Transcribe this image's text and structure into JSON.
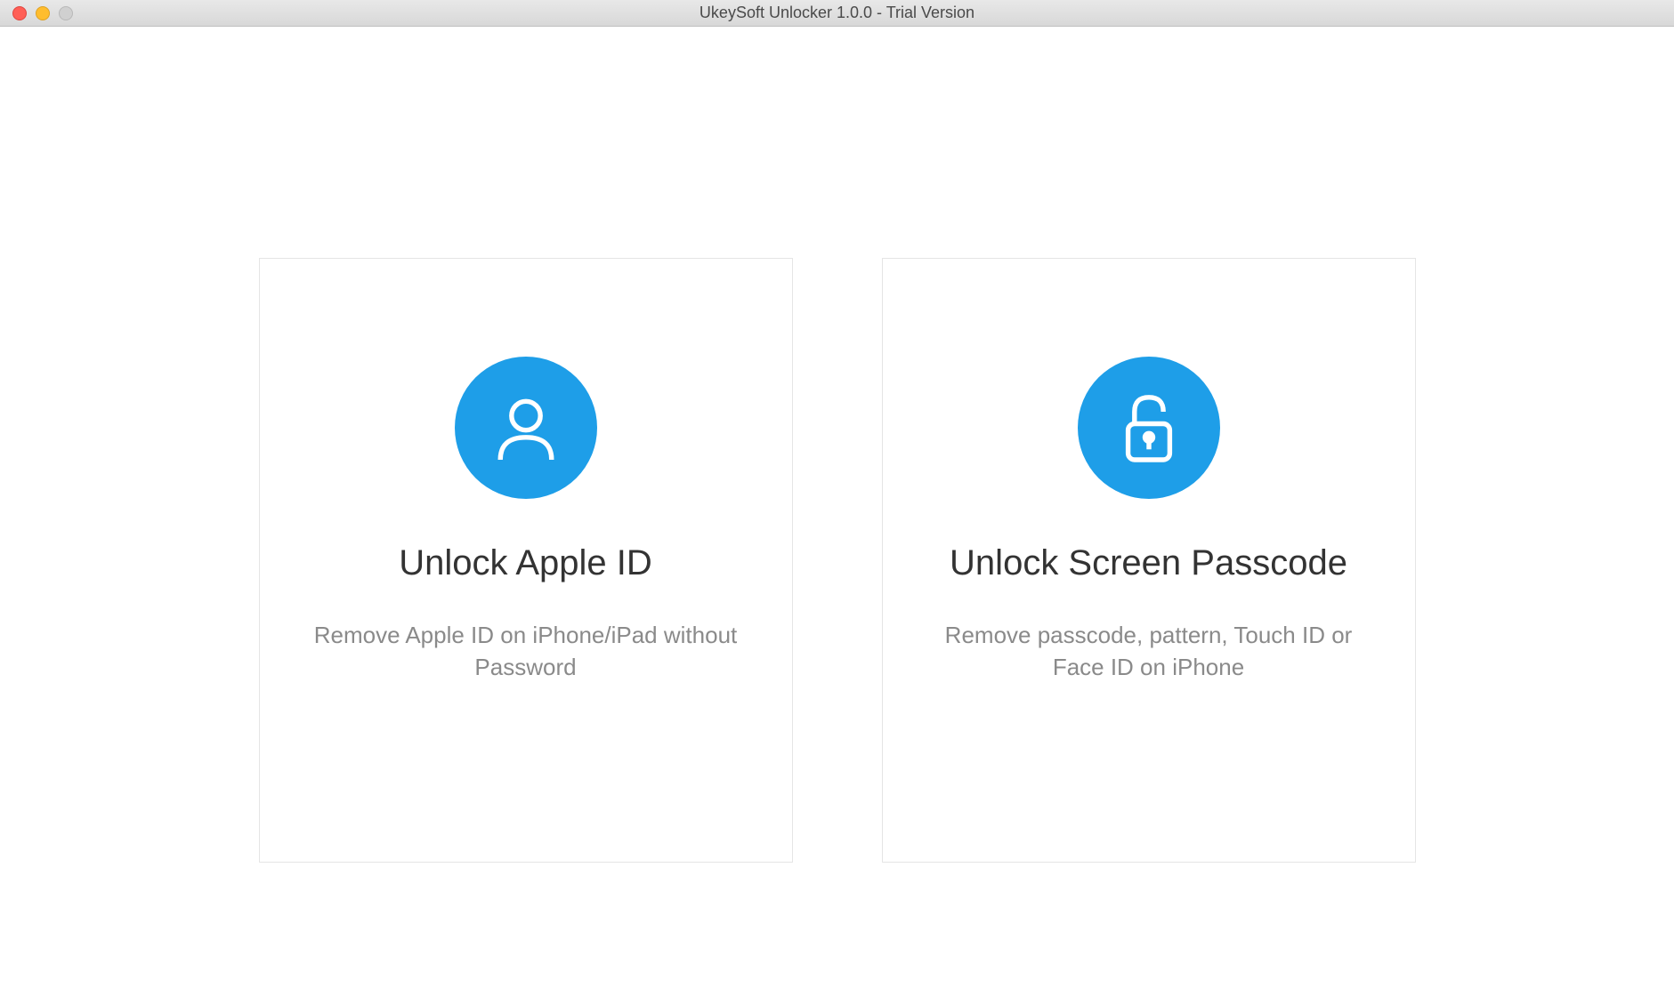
{
  "window": {
    "title": "UkeySoft Unlocker 1.0.0 - Trial Version"
  },
  "options": {
    "appleId": {
      "title": "Unlock Apple ID",
      "description": "Remove Apple ID on iPhone/iPad without Password"
    },
    "screenPasscode": {
      "title": "Unlock Screen Passcode",
      "description": "Remove passcode, pattern, Touch ID or Face ID on iPhone"
    }
  }
}
